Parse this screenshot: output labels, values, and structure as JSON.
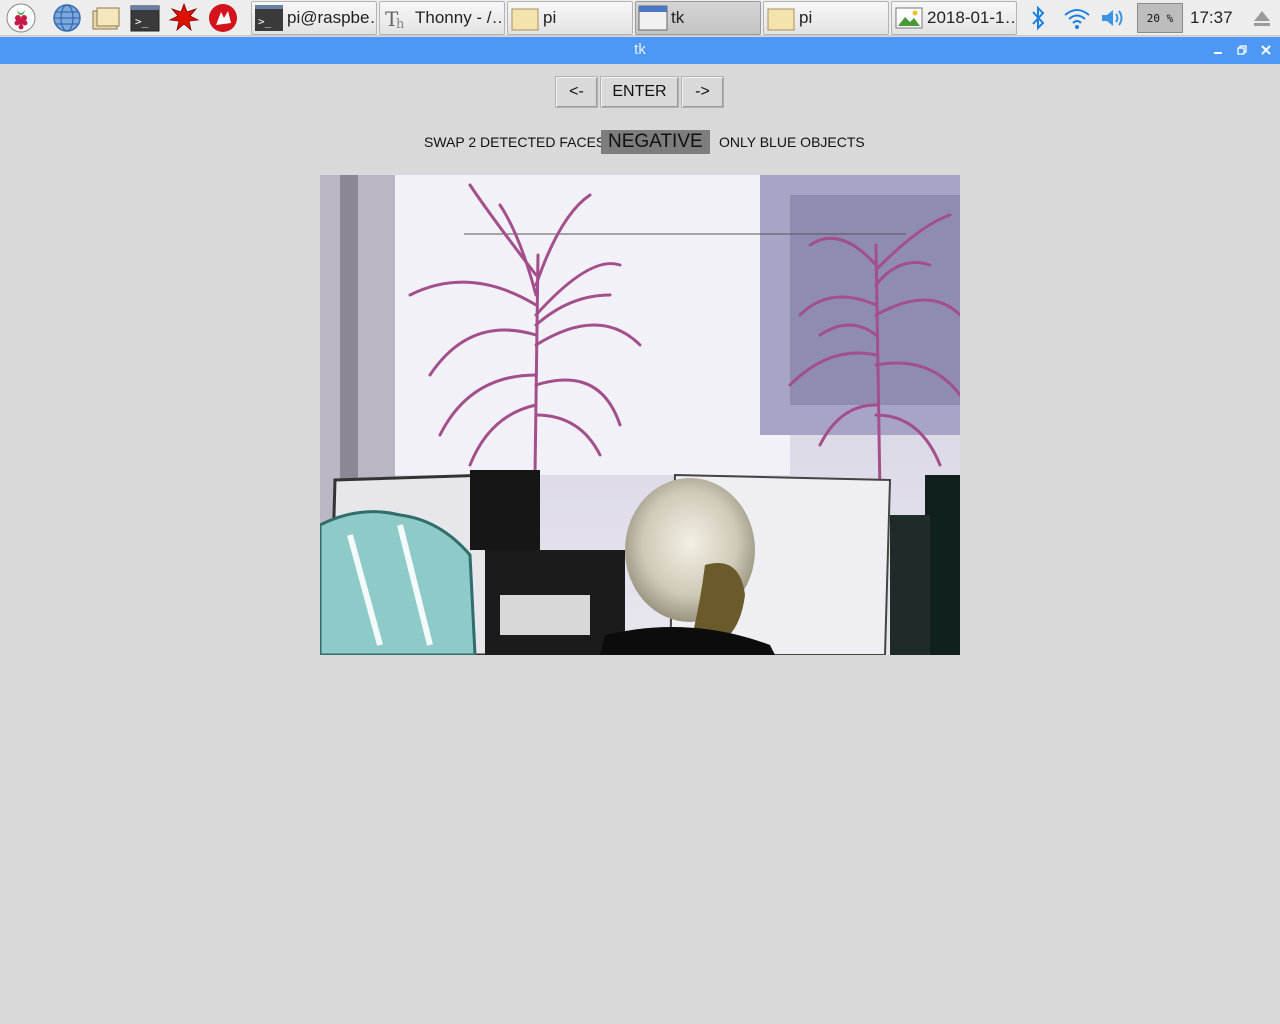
{
  "taskbar": {
    "launchers": [
      {
        "icon": "raspberry-pi-menu-icon"
      },
      {
        "icon": "web-browser-icon"
      },
      {
        "icon": "file-manager-icon"
      },
      {
        "icon": "terminal-icon"
      },
      {
        "icon": "mathematica-icon"
      },
      {
        "icon": "wolfram-icon"
      }
    ],
    "tasks": [
      {
        "icon": "terminal-icon",
        "label": "pi@raspbe…",
        "active": false
      },
      {
        "icon": "thonny-icon",
        "label": "Thonny  -  /…",
        "active": false
      },
      {
        "icon": "folder-icon",
        "label": "pi",
        "active": false
      },
      {
        "icon": "window-icon",
        "label": "tk",
        "active": true
      },
      {
        "icon": "folder-icon",
        "label": "pi",
        "active": false
      },
      {
        "icon": "image-viewer-icon",
        "label": "2018-01-1…",
        "active": false
      }
    ],
    "tray": {
      "battery": "20 %",
      "clock": "17:37"
    }
  },
  "window": {
    "title": "tk"
  },
  "app": {
    "buttons": {
      "prev": "<-",
      "enter": "ENTER",
      "next": "->"
    },
    "filters": {
      "left": "SWAP 2 DETECTED FACES",
      "selected": "NEGATIVE",
      "right": "ONLY BLUE OBJECTS"
    }
  },
  "colors": {
    "titlebar": "#4d98f5",
    "background": "#d9d9d9",
    "selected_filter": "#7d7d7d"
  }
}
